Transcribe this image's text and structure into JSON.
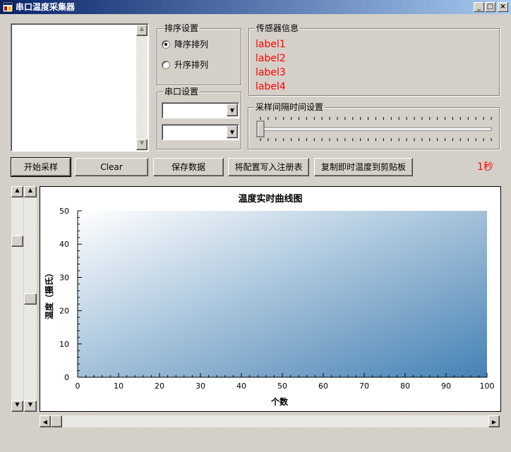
{
  "window": {
    "title": "串口温度采集器",
    "minimize": "_",
    "maximize": "□",
    "close": "×"
  },
  "sort": {
    "group_label": "排序设置",
    "options": [
      "降序排列",
      "升序排列"
    ],
    "selected": 0
  },
  "serial": {
    "group_label": "串口设置",
    "port_value": "",
    "baud_value": ""
  },
  "sensor": {
    "group_label": "传感器信息",
    "labels": [
      "label1",
      "label2",
      "label3",
      "label4"
    ],
    "label_color": "#ff0000"
  },
  "interval": {
    "group_label": "采样间隔时间设置",
    "slider_value": 0
  },
  "toolbar": {
    "buttons": [
      "开始采样",
      "Clear",
      "保存数据",
      "将配置写入注册表",
      "复制即时温度到剪贴板"
    ],
    "interval_display": "1秒"
  },
  "chart_data": {
    "type": "line",
    "title": "温度实时曲线图",
    "xlabel": "个数",
    "ylabel": "温度（摄氏）",
    "xlim": [
      0,
      100
    ],
    "ylim": [
      0,
      50
    ],
    "x_ticks": [
      "0",
      "10",
      "20",
      "30",
      "40",
      "50",
      "60",
      "70",
      "80",
      "90",
      "100"
    ],
    "y_ticks": [
      "0",
      "10",
      "20",
      "30",
      "40",
      "50"
    ],
    "series": [],
    "gradient": [
      "#ffffff",
      "#4682b4"
    ]
  },
  "icons": {
    "up": "up-arrow-icon",
    "down": "down-arrow-icon",
    "left": "left-arrow-icon",
    "right": "right-arrow-icon",
    "dropdown": "chevron-down-icon"
  }
}
